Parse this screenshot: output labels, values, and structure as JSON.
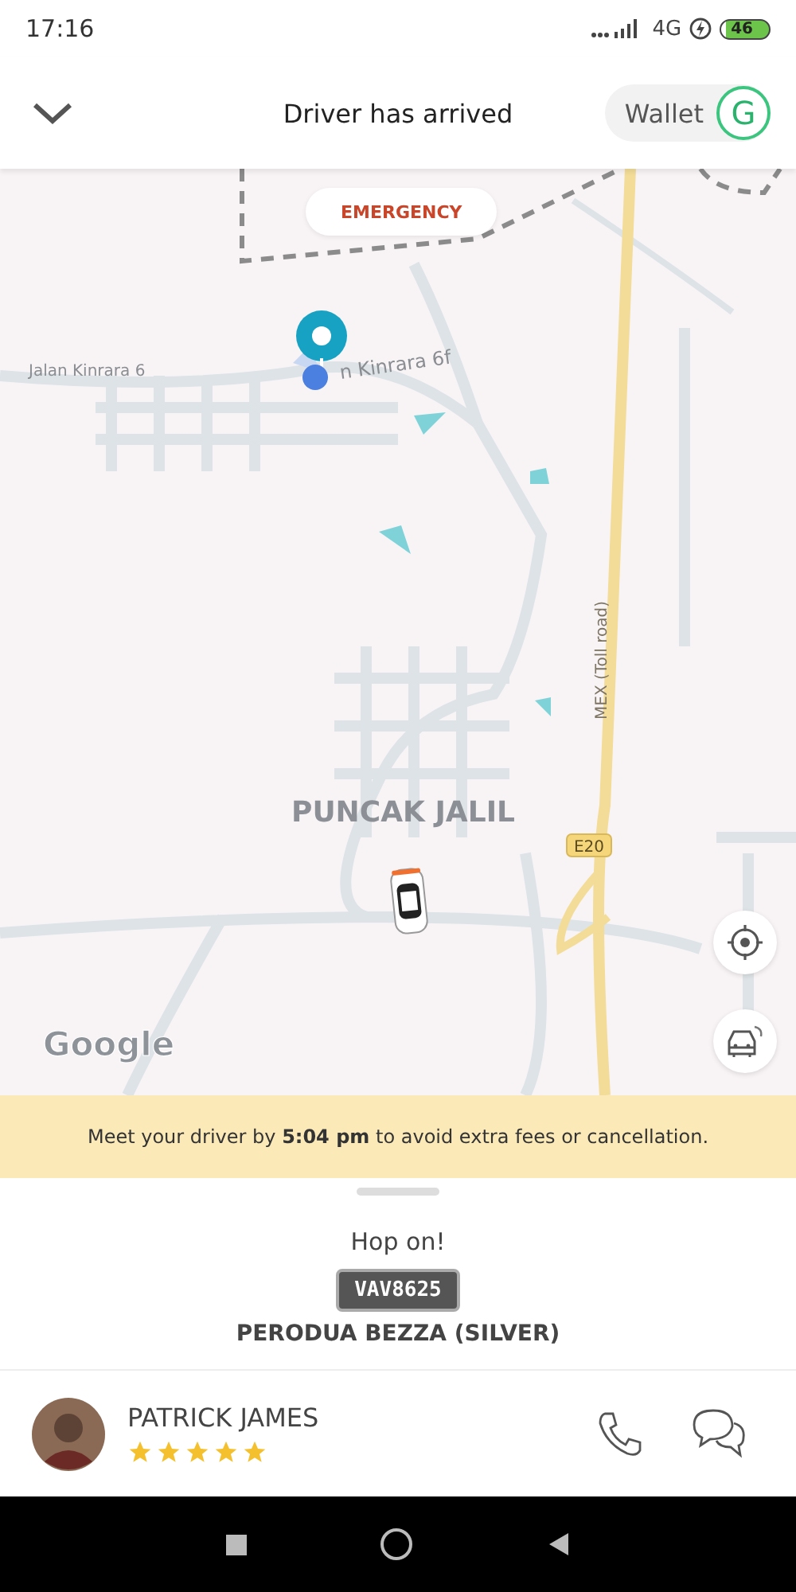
{
  "status_bar": {
    "time": "17:16",
    "network": "4G",
    "battery": "46"
  },
  "header": {
    "title": "Driver has arrived",
    "wallet_label": "Wallet",
    "wallet_badge": "G"
  },
  "map": {
    "emergency_button": "EMERGENCY",
    "labels": [
      {
        "text": "Jalan Kinrara 6",
        "kind": "street"
      },
      {
        "text": "n Kinrara 6f",
        "kind": "street"
      },
      {
        "text": "PUNCAK JALIL",
        "kind": "area"
      },
      {
        "text": "MEX (Toll road)",
        "kind": "highway"
      }
    ],
    "road_shield": "E20",
    "logo": "Google"
  },
  "banner": {
    "text": "Meet your driver by **5:04 pm** to avoid extra fees or cancellation."
  },
  "trip": {
    "heading": "Hop on!",
    "plate": "VAV8625",
    "vehicle": "PERODUA BEZZA (SILVER)"
  },
  "driver": {
    "name": "PATRICK JAMES",
    "stars": 5
  }
}
